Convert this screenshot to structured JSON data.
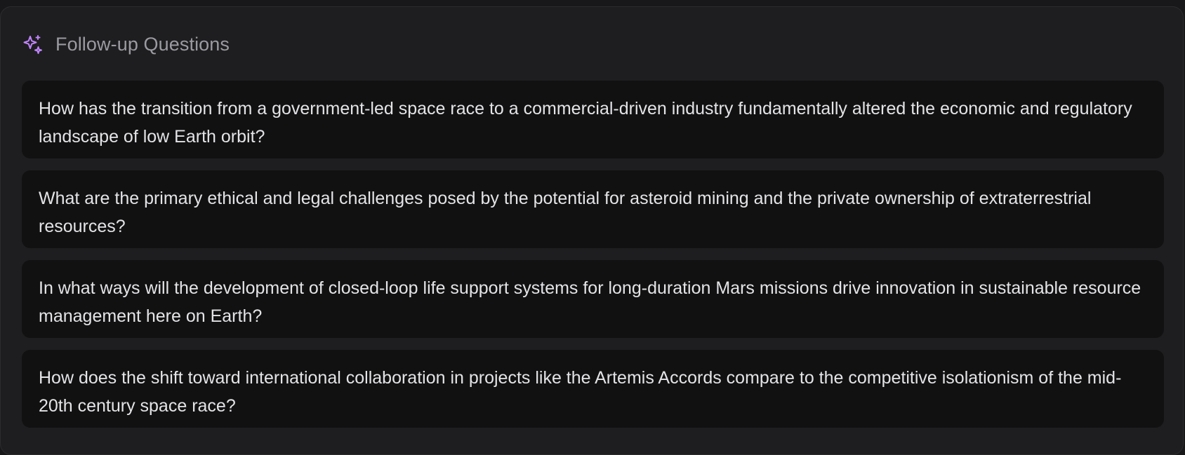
{
  "panel": {
    "header": {
      "icon": "sparkles-icon",
      "title": "Follow-up Questions",
      "accent_color": "#c084fc"
    },
    "questions": [
      "How has the transition from a government-led space race to a commercial-driven industry fundamentally altered the economic and regulatory landscape of low Earth orbit?",
      "What are the primary ethical and legal challenges posed by the potential for asteroid mining and the private ownership of extraterrestrial resources?",
      "In what ways will the development of closed-loop life support systems for long-duration Mars missions drive innovation in sustainable resource management here on Earth?",
      "How does the shift toward international collaboration in projects like the Artemis Accords compare to the competitive isolationism of the mid-20th century space race?"
    ]
  }
}
